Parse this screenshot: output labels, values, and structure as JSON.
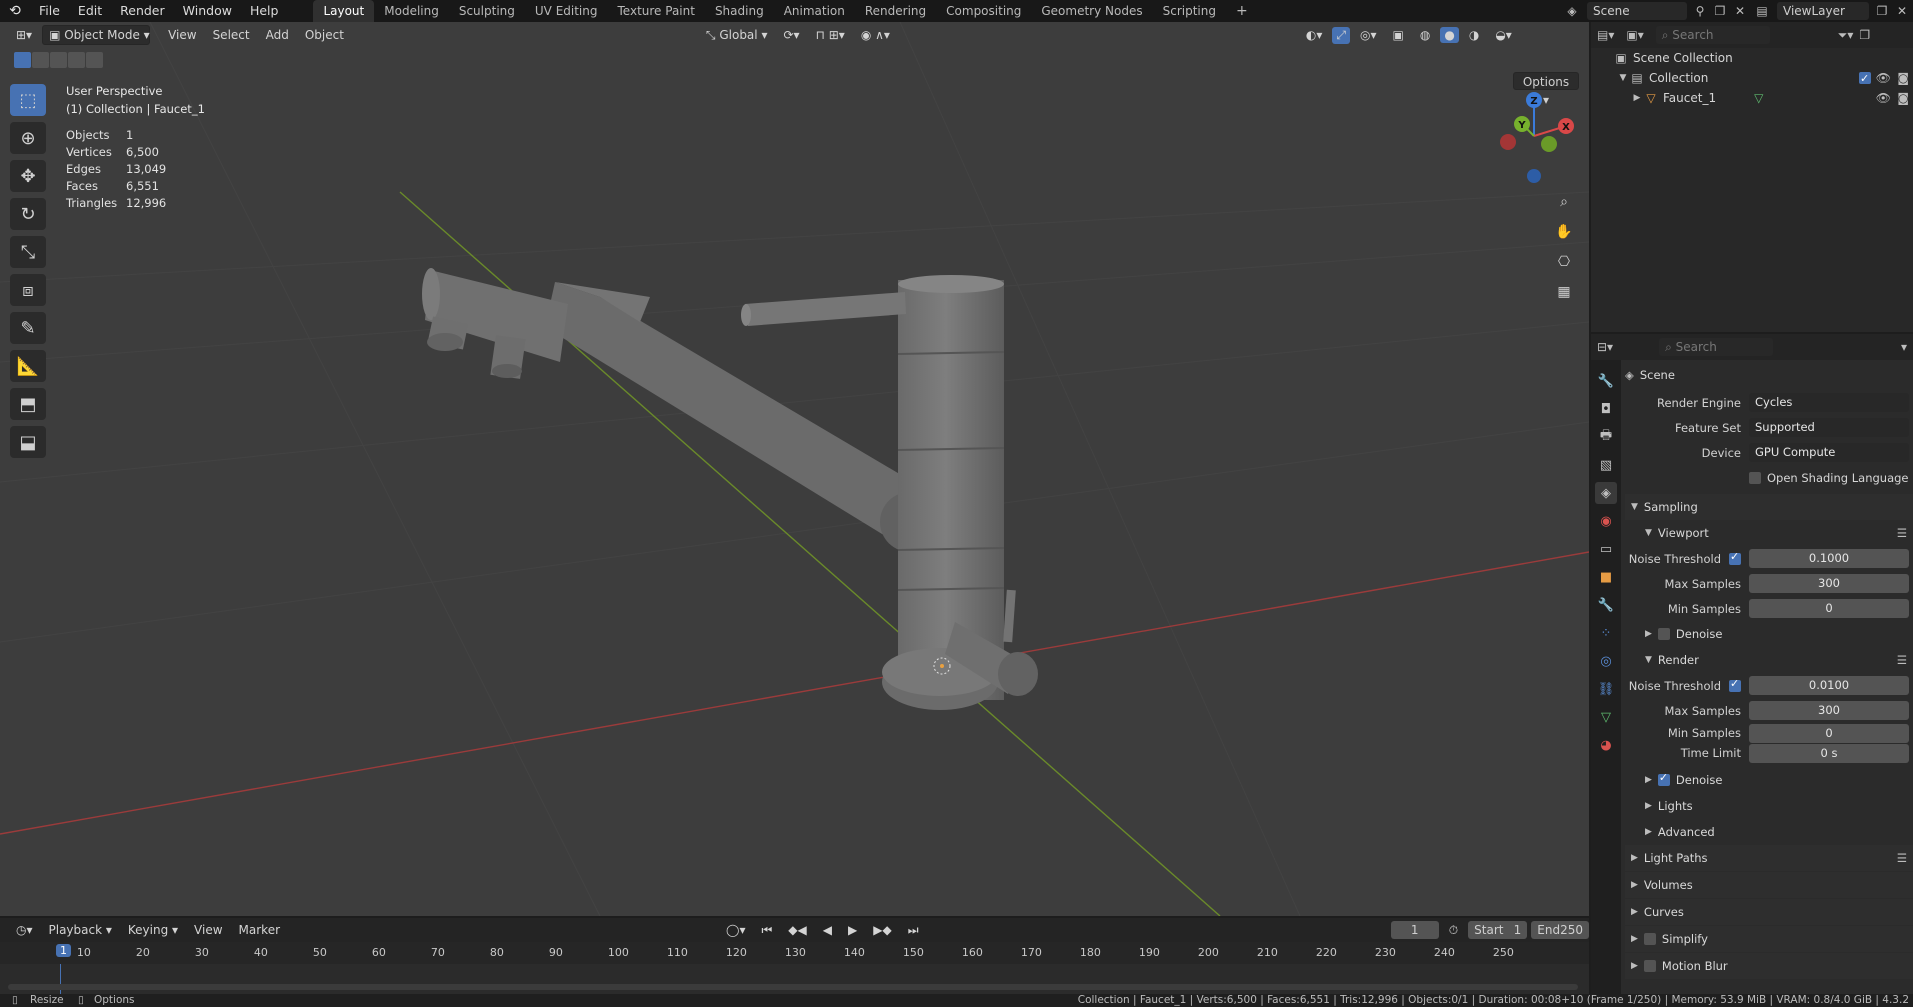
{
  "topbar": {
    "menus": [
      "File",
      "Edit",
      "Render",
      "Window",
      "Help"
    ],
    "workspaces": [
      "Layout",
      "Modeling",
      "Sculpting",
      "UV Editing",
      "Texture Paint",
      "Shading",
      "Animation",
      "Rendering",
      "Compositing",
      "Geometry Nodes",
      "Scripting"
    ],
    "active_workspace": "Layout",
    "scene": "Scene",
    "view_layer": "ViewLayer"
  },
  "viewport": {
    "mode": "Object Mode",
    "menus": [
      "View",
      "Select",
      "Add",
      "Object"
    ],
    "orientation": "Global",
    "options_label": "Options",
    "view_name": "User Perspective",
    "collection_info": "(1) Collection | Faucet_1",
    "stats": [
      {
        "label": "Objects",
        "value": "1"
      },
      {
        "label": "Vertices",
        "value": "6,500"
      },
      {
        "label": "Edges",
        "value": "13,049"
      },
      {
        "label": "Faces",
        "value": "6,551"
      },
      {
        "label": "Triangles",
        "value": "12,996"
      }
    ],
    "gizmo": {
      "x": "X",
      "y": "Y",
      "z": "Z"
    }
  },
  "outliner": {
    "search_placeholder": "Search",
    "root": "Scene Collection",
    "collection": "Collection",
    "object": "Faucet_1"
  },
  "properties": {
    "search_placeholder": "Search",
    "context": "Scene",
    "render_engine_label": "Render Engine",
    "render_engine": "Cycles",
    "feature_set_label": "Feature Set",
    "feature_set": "Supported",
    "device_label": "Device",
    "device": "GPU Compute",
    "osl_label": "Open Shading Language",
    "sampling": "Sampling",
    "viewport_panel": "Viewport",
    "noise_threshold_label": "Noise Threshold",
    "viewport_noise_threshold": "0.1000",
    "max_samples_label": "Max Samples",
    "viewport_max_samples": "300",
    "min_samples_label": "Min Samples",
    "viewport_min_samples": "0",
    "denoise_label": "Denoise",
    "render_panel": "Render",
    "render_noise_threshold": "0.0100",
    "render_max_samples": "300",
    "render_min_samples": "0",
    "time_limit_label": "Time Limit",
    "time_limit": "0 s",
    "lights": "Lights",
    "advanced": "Advanced",
    "light_paths": "Light Paths",
    "volumes": "Volumes",
    "curves": "Curves",
    "simplify": "Simplify",
    "motion_blur": "Motion Blur"
  },
  "timeline": {
    "menus": [
      "Playback",
      "Keying",
      "View",
      "Marker"
    ],
    "current_frame": "1",
    "start_label": "Start",
    "start": "1",
    "end_label": "End",
    "end": "250",
    "ticks": [
      "1",
      "10",
      "20",
      "30",
      "40",
      "50",
      "60",
      "70",
      "80",
      "90",
      "100",
      "110",
      "120",
      "130",
      "140",
      "150",
      "160",
      "170",
      "180",
      "190",
      "200",
      "210",
      "220",
      "230",
      "240",
      "250"
    ]
  },
  "statusbar": {
    "left1": "Resize",
    "left2": "Options",
    "right": "Collection | Faucet_1 | Verts:6,500 | Faces:6,551 | Tris:12,996 | Objects:0/1 | Duration: 00:08+10 (Frame 1/250) | Memory: 53.9 MiB | VRAM: 0.8/4.0 GiB | 4.3.2"
  }
}
